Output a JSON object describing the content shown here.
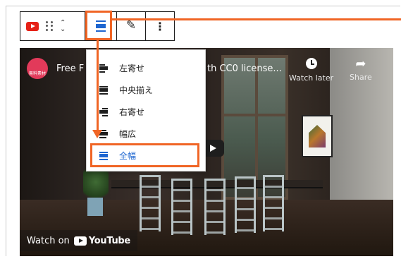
{
  "toolbar": {
    "icons": {
      "youtube": "youtube-icon",
      "drag": "drag-handle-icon",
      "mover": "move-up-down-icon",
      "align": "align-full-icon",
      "edit": "pencil-icon",
      "more": "more-vertical-icon"
    },
    "mover_up": "⌃",
    "mover_down": "⌄",
    "more_glyph": "⋮",
    "edit_glyph": "✎"
  },
  "video": {
    "title_start": "Free F",
    "title_end": "th CC0 license...",
    "channel_logo_text": "無料素材",
    "watch_later_label": "Watch later",
    "share_label": "Share",
    "watch_on_label": "Watch on",
    "youtube_label": "YouTube"
  },
  "align_menu": {
    "items": [
      {
        "label": "左寄せ",
        "icon": "align-left-icon"
      },
      {
        "label": "中央揃え",
        "icon": "align-center-icon"
      },
      {
        "label": "右寄せ",
        "icon": "align-right-icon"
      },
      {
        "label": "幅広",
        "icon": "align-wide-icon"
      },
      {
        "label": "全幅",
        "icon": "align-full-icon",
        "active": true
      }
    ]
  },
  "colors": {
    "highlight": "#f06525",
    "accent": "#1e66d0",
    "youtube_red": "#e62117"
  }
}
